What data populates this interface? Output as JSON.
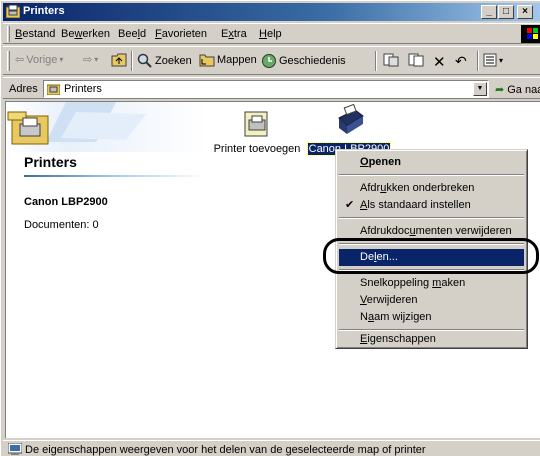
{
  "window": {
    "title": "Printers"
  },
  "menu": [
    {
      "pre": "",
      "u": "B",
      "post": "estand"
    },
    {
      "pre": "Be",
      "u": "w",
      "post": "erken"
    },
    {
      "pre": "Bee",
      "u": "l",
      "post": "d"
    },
    {
      "pre": "",
      "u": "F",
      "post": "avorieten"
    },
    {
      "pre": "E",
      "u": "x",
      "post": "tra"
    },
    {
      "pre": "",
      "u": "H",
      "post": "elp"
    }
  ],
  "toolbar": {
    "back_label": "Vorige",
    "search_label": "Zoeken",
    "folders_label": "Mappen",
    "history_label": "Geschiedenis"
  },
  "address": {
    "label": "Adres",
    "value": "Printers",
    "go_label": "Ga naar"
  },
  "content": {
    "heading": "Printers",
    "selected_name": "Canon LBP2900",
    "documents": "Documenten: 0",
    "items": [
      {
        "label": "Printer toevoegen"
      },
      {
        "label": "Canon LBP2900"
      }
    ]
  },
  "context_menu": {
    "open": {
      "u": "O",
      "post": "penen"
    },
    "pause": {
      "pre": "Afdr",
      "u": "u",
      "post": "kken onderbreken"
    },
    "set_default": {
      "pre": "",
      "u": "A",
      "post": "ls standaard instellen"
    },
    "cancel_docs": {
      "pre": "Afdrukdoc",
      "u": "u",
      "post": "menten verwijderen"
    },
    "share": {
      "pre": "De",
      "u": "l",
      "post": "en..."
    },
    "shortcut": {
      "pre": "Snelkoppeling ",
      "u": "m",
      "post": "aken"
    },
    "delete": {
      "pre": "",
      "u": "V",
      "post": "erwijderen"
    },
    "rename": {
      "pre": "N",
      "u": "a",
      "post": "am wijzigen"
    },
    "properties": {
      "pre": "",
      "u": "E",
      "post": "igenschappen"
    }
  },
  "status": {
    "text": "De eigenschappen weergeven voor het delen van de geselecteerde map of printer"
  }
}
